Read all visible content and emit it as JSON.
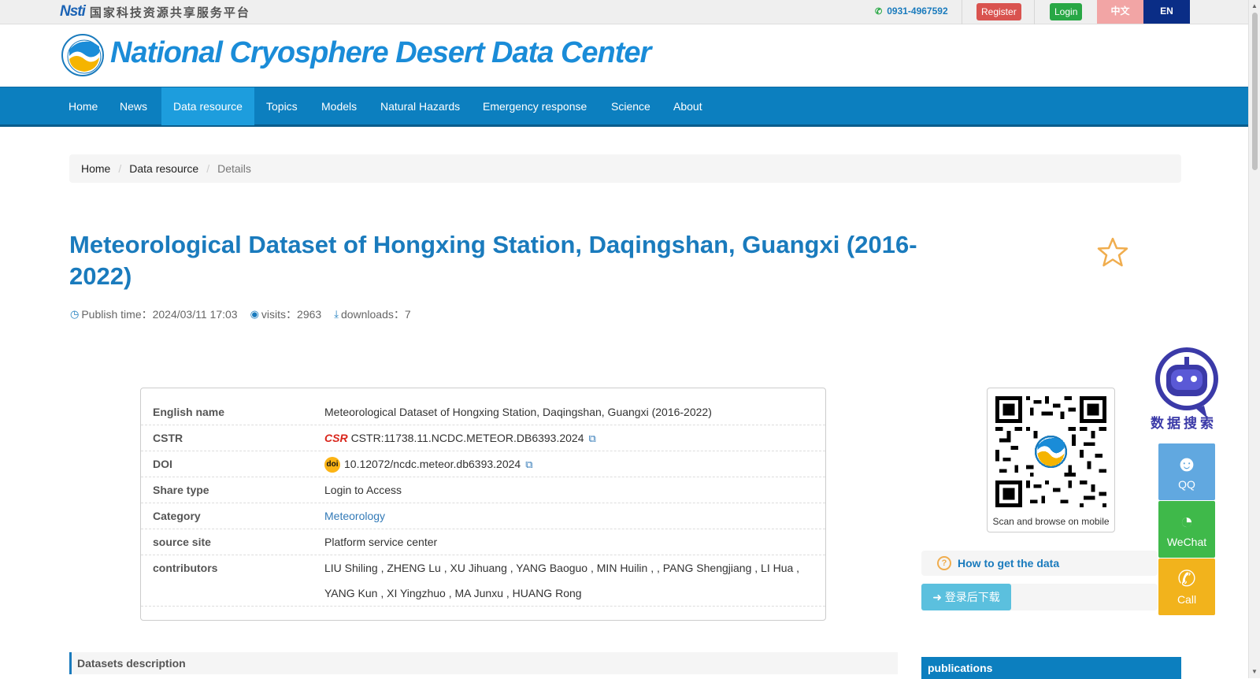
{
  "topbar": {
    "nsti_mark": "Nsti",
    "nsti_text": "国家科技资源共享服务平台",
    "phone": "0931-4967592",
    "register_label": "Register",
    "login_label": "Login",
    "lang_zh": "中文",
    "lang_en": "EN"
  },
  "header": {
    "site_title": "National Cryosphere Desert Data Center"
  },
  "nav": {
    "items": [
      {
        "label": "Home"
      },
      {
        "label": "News"
      },
      {
        "label": "Data resource",
        "active": true
      },
      {
        "label": "Topics"
      },
      {
        "label": "Models"
      },
      {
        "label": "Natural Hazards"
      },
      {
        "label": "Emergency response"
      },
      {
        "label": "Science"
      },
      {
        "label": "About"
      }
    ]
  },
  "breadcrumb": {
    "home": "Home",
    "section": "Data resource",
    "current": "Details",
    "separator": "/"
  },
  "dataset": {
    "title": "Meteorological Dataset of Hongxing Station, Daqingshan, Guangxi (2016-2022)",
    "publish_label": "Publish time：",
    "publish_time": "2024/03/11 17:03",
    "visits_label": "visits：",
    "visits": "2963",
    "downloads_label": "downloads：",
    "downloads": "7"
  },
  "info": {
    "english_name_label": "English name",
    "english_name": "Meteorological Dataset of Hongxing Station, Daqingshan, Guangxi (2016-2022)",
    "cstr_label": "CSTR",
    "cstr_badge": "CSR",
    "cstr": "CSTR:11738.11.NCDC.METEOR.DB6393.2024",
    "doi_label": "DOI",
    "doi_badge": "doi",
    "doi": "10.12072/ncdc.meteor.db6393.2024",
    "share_type_label": "Share type",
    "share_type": "Login to Access",
    "category_label": "Category",
    "category": "Meteorology",
    "source_site_label": "source site",
    "source_site": "Platform service center",
    "contributors_label": "contributors",
    "contributors": "LIU Shiling , ZHENG Lu , XU Jihuang , YANG Baoguo , MIN Huilin , , PANG Shengjiang , LI Hua , YANG Kun , XI Yingzhuo , MA Junxu , HUANG Rong"
  },
  "sidebar": {
    "qr_caption": "Scan and browse on mobile",
    "howto_label": "How to get the data",
    "download_label": "登录后下载",
    "robot_label": "数据搜索",
    "qq_label": "QQ",
    "wechat_label": "WeChat",
    "call_label": "Call"
  },
  "sections": {
    "description": "Datasets description",
    "publications": "publications"
  },
  "colors": {
    "primary": "#0c7fbf",
    "title": "#1a7bbd",
    "register": "#d9534f",
    "login": "#28a745"
  }
}
